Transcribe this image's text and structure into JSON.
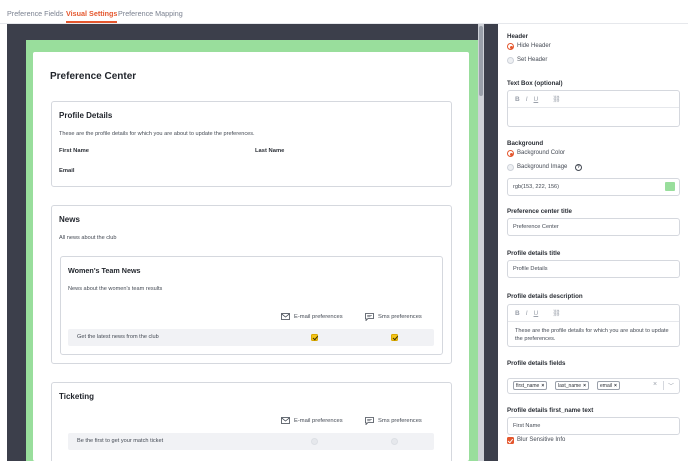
{
  "tabs": [
    {
      "label": "Preference Fields"
    },
    {
      "label": "Visual Settings",
      "active": true
    },
    {
      "label": "Preference Mapping"
    }
  ],
  "preview": {
    "title": "Preference Center",
    "profile": {
      "title": "Profile Details",
      "description": "These are the profile details for which you are about to update the preferences.",
      "first_name": "First Name",
      "last_name": "Last Name",
      "email": "Email"
    },
    "news": {
      "title": "News",
      "description": "All news about the club",
      "sub": {
        "title": "Women's Team News",
        "description": "News about the women's team results",
        "email_pref": "E-mail preferences",
        "sms_pref": "Sms preferences",
        "row": {
          "label": "Get the latest news from the club",
          "email": true,
          "sms": true
        }
      }
    },
    "ticketing": {
      "title": "Ticketing",
      "email_pref": "E-mail preferences",
      "sms_pref": "Sms preferences",
      "row": {
        "label": "Be the first to get your match ticket",
        "email": false,
        "sms": false
      }
    }
  },
  "settings": {
    "header_label": "Header",
    "hide_header": "Hide Header",
    "set_header": "Set Header",
    "header_choice": "Hide Header",
    "textbox_label": "Text Box (optional)",
    "background_label": "Background",
    "bg_color": "Background Color",
    "bg_image": "Background Image",
    "bg_choice": "Background Color",
    "bg_value": "rgb(153, 222, 156)",
    "bg_swatch": "#99de9c",
    "pc_title_label": "Preference center title",
    "pc_title_value": "Preference Center",
    "pd_title_label": "Profile details title",
    "pd_title_value": "Profile Details",
    "pd_desc_label": "Profile details description",
    "pd_desc_value": "These are the profile details for which you are about to update the preferences.",
    "pd_fields_label": "Profile details fields",
    "pd_fields": [
      "first_name",
      "last_name",
      "email"
    ],
    "fn_text_label": "Profile details first_name text",
    "fn_text_value": "First Name",
    "blur_label": "Blur Sensitive Info",
    "blur_checked": true
  },
  "colors": {
    "accent": "#e4572e",
    "checkbox": "#f5c518",
    "preview_bg": "#3c3f4b",
    "frame_green": "#99de9c"
  }
}
